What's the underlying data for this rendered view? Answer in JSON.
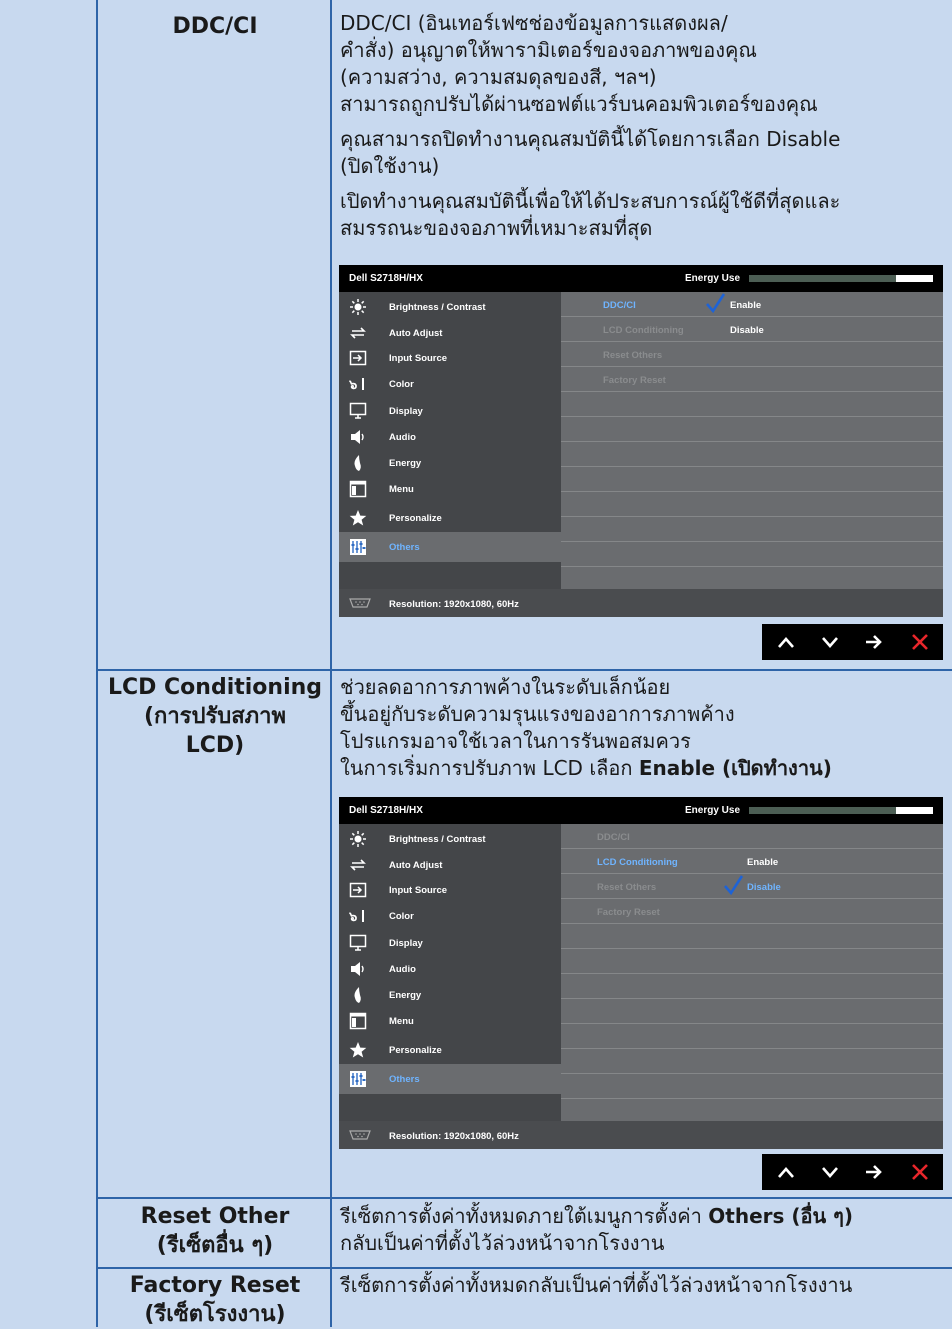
{
  "rows": {
    "ddc": {
      "label": "DDC/CI",
      "desc": [
        "DDC/CI (อินเทอร์เฟซช่องข้อมูลการแสดงผล/",
        "คำสั่ง) อนุญาตให้พารามิเตอร์ของจอภาพของคุณ",
        "(ความสว่าง, ความสมดุลของสี, ฯลฯ)",
        "สามารถถูกปรับได้ผ่านซอฟต์แวร์บนคอมพิวเตอร์ของคุณ"
      ],
      "desc2": [
        "คุณสามารถปิดทำงานคุณสมบัตินี้ได้โดยการเลือก Disable",
        "(ปิดใช้งาน)"
      ],
      "desc3": [
        "เปิดทำงานคุณสมบัตินี้เพื่อให้ได้ประสบการณ์ผู้ใช้ดีที่สุดและ",
        "สมรรถนะของจอภาพที่เหมาะสมที่สุด"
      ]
    },
    "lcd": {
      "label": [
        "LCD Conditioning",
        "(การปรับสภาพ",
        "LCD)"
      ],
      "desc": [
        "ช่วยลดอาการภาพค้างในระดับเล็กน้อย",
        "ขึ้นอยู่กับระดับความรุนแรงของอาการภาพค้าง",
        "โปรแกรมอาจใช้เวลาในการรันพอสมควร"
      ],
      "desc_last_prefix": "ในการเริ่มการปรับภาพ LCD เลือก ",
      "desc_last_bold": "Enable (เปิดทำงาน)"
    },
    "reset_other": {
      "label": [
        "Reset Other",
        "(รีเซ็ตอื่น ๆ)"
      ],
      "desc_prefix": "รีเซ็ตการตั้งค่าทั้งหมดภายใต้เมนูการตั้งค่า ",
      "desc_bold": "Others (อื่น ๆ)",
      "desc_line2": "กลับเป็นค่าที่ตั้งไว้ล่วงหน้าจากโรงงาน"
    },
    "factory": {
      "label": [
        "Factory Reset",
        "(รีเซ็ตโรงงาน)"
      ],
      "desc": "รีเซ็ตการตั้งค่าทั้งหมดกลับเป็นค่าที่ตั้งไว้ล่วงหน้าจากโรงงาน"
    }
  },
  "osd": {
    "model": "Dell S2718H/HX",
    "energy_label": "Energy Use",
    "energy_level": 0.2,
    "menu": [
      "Brightness / Contrast",
      "Auto Adjust",
      "Input Source",
      "Color",
      "Display",
      "Audio",
      "Energy",
      "Menu",
      "Personalize",
      "Others"
    ],
    "resolution": "Resolution: 1920x1080, 60Hz",
    "submenu": [
      "DDC/CI",
      "LCD Conditioning",
      "Reset Others",
      "Factory Reset"
    ],
    "enable": "Enable",
    "disable": "Disable"
  },
  "colors": {
    "background": "#c8d9ef",
    "border": "#2e64a8",
    "accent": "#6fb4ff",
    "close": "#e8262b"
  },
  "icons": [
    "brightness-icon",
    "auto-adjust-icon",
    "input-source-icon",
    "color-icon",
    "display-icon",
    "audio-icon",
    "energy-icon",
    "menu-icon",
    "personalize-icon",
    "others-icon",
    "vga-icon",
    "check-icon",
    "up-icon",
    "down-icon",
    "right-icon",
    "close-icon"
  ]
}
